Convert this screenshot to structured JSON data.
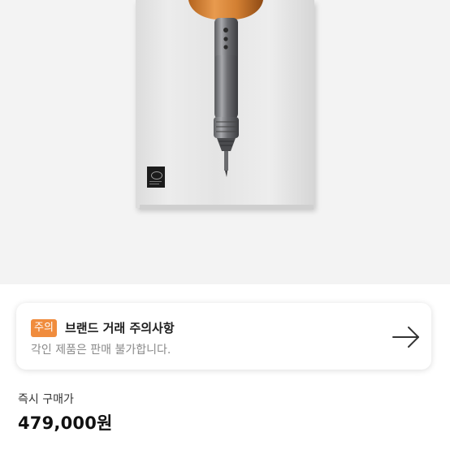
{
  "notice": {
    "badge": "주의",
    "title": "브랜드 거래 주의사항",
    "subtitle": "각인 제품은 판매 불가합니다.",
    "arrow_icon": "arrow-right-icon"
  },
  "price": {
    "label": "즉시 구매가",
    "value": "479,000원"
  },
  "colors": {
    "accent": "#f08c3d"
  }
}
